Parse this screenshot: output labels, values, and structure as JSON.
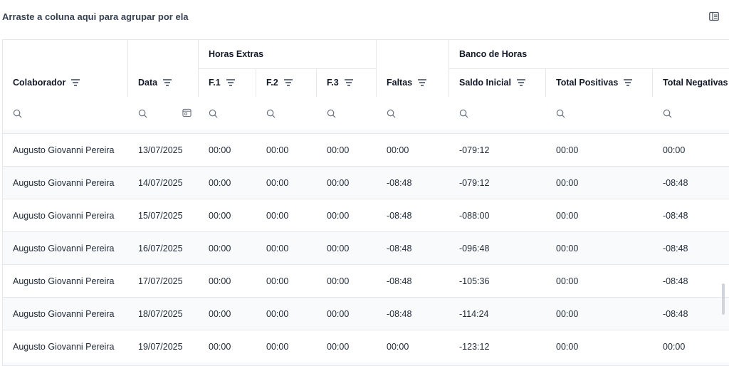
{
  "group_bar": {
    "label": "Arraste a coluna aqui para agrupar por ela",
    "icon": "columns-panel-icon"
  },
  "header": {
    "groups": {
      "horas_extras": "Horas Extras",
      "banco_de_horas": "Banco de Horas"
    },
    "columns": {
      "colaborador": "Colaborador",
      "data": "Data",
      "f1": "F.1",
      "f2": "F.2",
      "f3": "F.3",
      "faltas": "Faltas",
      "saldo_inicial": "Saldo Inicial",
      "total_positivas": "Total Positivas",
      "total_negativas": "Total Negativas"
    },
    "sort_icon": "sort-filter-icon"
  },
  "filters": {
    "search_icon": "search-icon",
    "calendar_icon": "calendar-icon"
  },
  "rows": [
    {
      "colaborador": "Augusto Giovanni Pereira",
      "data": "13/07/2025",
      "f1": "00:00",
      "f2": "00:00",
      "f3": "00:00",
      "faltas": "00:00",
      "saldo_inicial": "-079:12",
      "total_positivas": "00:00",
      "total_negativas": "00:00"
    },
    {
      "colaborador": "Augusto Giovanni Pereira",
      "data": "14/07/2025",
      "f1": "00:00",
      "f2": "00:00",
      "f3": "00:00",
      "faltas": "-08:48",
      "saldo_inicial": "-079:12",
      "total_positivas": "00:00",
      "total_negativas": "-08:48"
    },
    {
      "colaborador": "Augusto Giovanni Pereira",
      "data": "15/07/2025",
      "f1": "00:00",
      "f2": "00:00",
      "f3": "00:00",
      "faltas": "-08:48",
      "saldo_inicial": "-088:00",
      "total_positivas": "00:00",
      "total_negativas": "-08:48"
    },
    {
      "colaborador": "Augusto Giovanni Pereira",
      "data": "16/07/2025",
      "f1": "00:00",
      "f2": "00:00",
      "f3": "00:00",
      "faltas": "-08:48",
      "saldo_inicial": "-096:48",
      "total_positivas": "00:00",
      "total_negativas": "-08:48"
    },
    {
      "colaborador": "Augusto Giovanni Pereira",
      "data": "17/07/2025",
      "f1": "00:00",
      "f2": "00:00",
      "f3": "00:00",
      "faltas": "-08:48",
      "saldo_inicial": "-105:36",
      "total_positivas": "00:00",
      "total_negativas": "-08:48"
    },
    {
      "colaborador": "Augusto Giovanni Pereira",
      "data": "18/07/2025",
      "f1": "00:00",
      "f2": "00:00",
      "f3": "00:00",
      "faltas": "-08:48",
      "saldo_inicial": "-114:24",
      "total_positivas": "00:00",
      "total_negativas": "-08:48"
    },
    {
      "colaborador": "Augusto Giovanni Pereira",
      "data": "19/07/2025",
      "f1": "00:00",
      "f2": "00:00",
      "f3": "00:00",
      "faltas": "00:00",
      "saldo_inicial": "-123:12",
      "total_positivas": "00:00",
      "total_negativas": "00:00"
    }
  ]
}
